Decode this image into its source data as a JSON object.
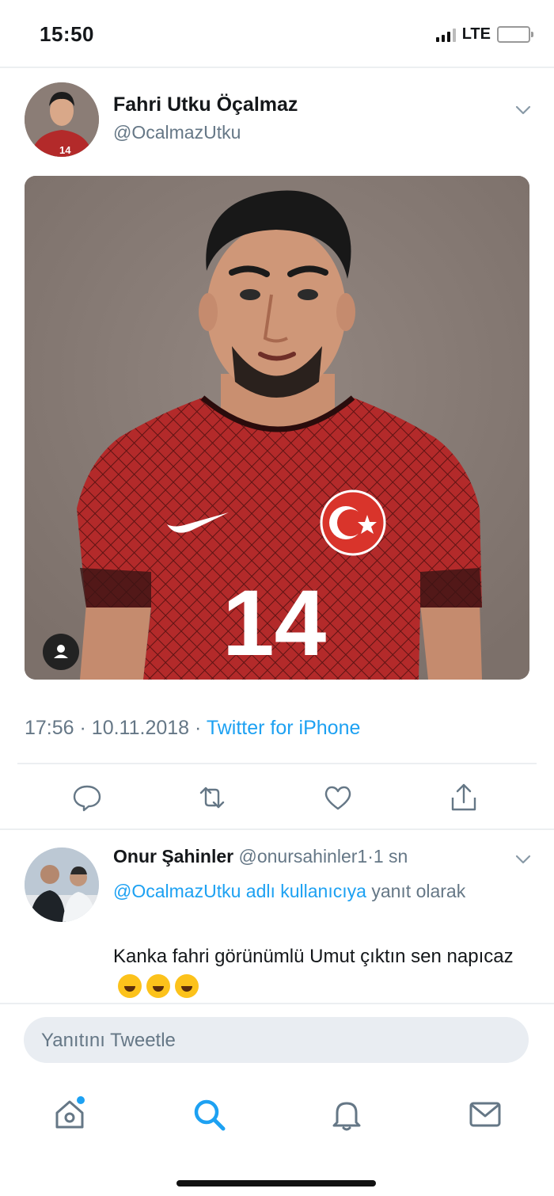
{
  "status_bar": {
    "time": "15:50",
    "network": "LTE"
  },
  "tweet": {
    "author_name": "Fahri Utku Öçalmaz",
    "author_handle": "@OcalmazUtku",
    "image_jersey_number": "14",
    "time": "17:56",
    "date": "10.11.2018",
    "separator": "·",
    "source": "Twitter for iPhone"
  },
  "actions": [
    "reply-icon",
    "retweet-icon",
    "like-icon",
    "share-icon"
  ],
  "reply": {
    "author_name": "Onur Şahinler",
    "author_handle": "@onursahinler1",
    "time": "1 sn",
    "mention": "@OcalmazUtku adlı kullanıcıya",
    "reply_suffix": "yanıt olarak",
    "text": "Kanka fahri görünümlü Umut çıktın sen napıcaz"
  },
  "compose": {
    "placeholder": "Yanıtını Tweetle"
  },
  "tab_bar": [
    "home-icon",
    "search-icon",
    "notifications-icon",
    "messages-icon"
  ],
  "colors": {
    "accent": "#1da1f2",
    "secondary_text": "#657786",
    "jersey_red": "#b32a2a"
  }
}
